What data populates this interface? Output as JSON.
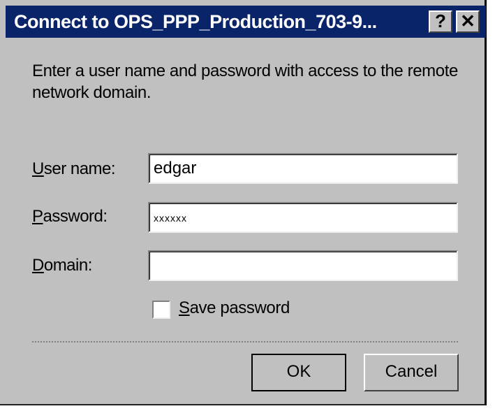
{
  "window": {
    "title": "Connect to OPS_PPP_Production_703-9...",
    "help_label": "?",
    "close_label": "✕"
  },
  "prompt": "Enter a user name and password with access to the remote network domain.",
  "fields": {
    "username": {
      "label_access": "U",
      "label_rest": "ser name:",
      "value": "edgar"
    },
    "password": {
      "label_access": "P",
      "label_rest": "assword:",
      "value": "xxxxxx"
    },
    "domain": {
      "label_access": "D",
      "label_rest": "omain:",
      "value": ""
    }
  },
  "save_password": {
    "label_access": "S",
    "label_rest": "ave password",
    "checked": false
  },
  "buttons": {
    "ok": "OK",
    "cancel": "Cancel"
  }
}
